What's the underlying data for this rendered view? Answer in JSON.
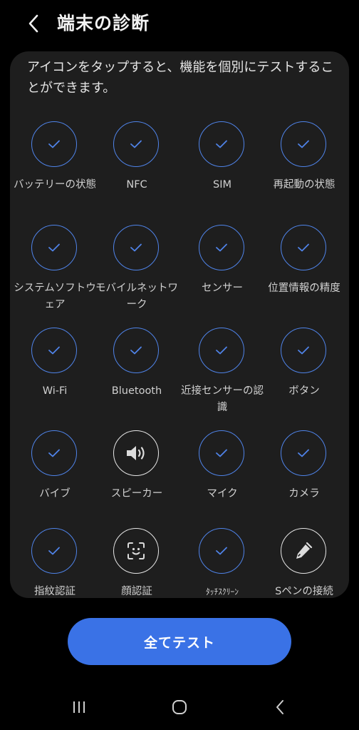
{
  "header": {
    "title": "端末の診断"
  },
  "intro": {
    "text": "アイコンをタップすると、機能を個別にテストすることができます。"
  },
  "tests": [
    {
      "label": "バッテリーの状態",
      "icon": "check-icon",
      "status": "passed"
    },
    {
      "label": "NFC",
      "icon": "check-icon",
      "status": "passed"
    },
    {
      "label": "SIM",
      "icon": "check-icon",
      "status": "passed"
    },
    {
      "label": "再起動の状態",
      "icon": "check-icon",
      "status": "passed"
    },
    {
      "label": "システムソフトウェア",
      "icon": "check-icon",
      "status": "passed"
    },
    {
      "label": "モバイルネットワーク",
      "icon": "check-icon",
      "status": "passed"
    },
    {
      "label": "センサー",
      "icon": "check-icon",
      "status": "passed"
    },
    {
      "label": "位置情報の精度",
      "icon": "check-icon",
      "status": "passed"
    },
    {
      "label": "Wi-Fi",
      "icon": "check-icon",
      "status": "passed"
    },
    {
      "label": "Bluetooth",
      "icon": "check-icon",
      "status": "passed"
    },
    {
      "label": "近接センサーの認識",
      "icon": "check-icon",
      "status": "passed"
    },
    {
      "label": "ボタン",
      "icon": "check-icon",
      "status": "passed"
    },
    {
      "label": "バイブ",
      "icon": "check-icon",
      "status": "passed"
    },
    {
      "label": "スピーカー",
      "icon": "speaker-icon",
      "status": "untested"
    },
    {
      "label": "マイク",
      "icon": "check-icon",
      "status": "passed"
    },
    {
      "label": "カメラ",
      "icon": "check-icon",
      "status": "passed"
    },
    {
      "label": "指紋認証",
      "icon": "check-icon",
      "status": "passed"
    },
    {
      "label": "顔認証",
      "icon": "face-scan-icon",
      "status": "untested"
    },
    {
      "label": "ﾀｯﾁｽｸﾘｰﾝ",
      "icon": "check-icon",
      "status": "passed"
    },
    {
      "label": "Sペンの接続",
      "icon": "pen-icon",
      "status": "untested"
    }
  ],
  "actions": {
    "test_all": "全てテスト"
  },
  "navigation": {
    "items": [
      "recent-apps-icon",
      "home-icon",
      "back-icon"
    ]
  },
  "colors": {
    "background": "#000000",
    "card": "#1e1e1e",
    "passed_ring": "#4f83e8",
    "untested_ring": "#e6e6e6",
    "primary_button": "#3a72e6"
  }
}
